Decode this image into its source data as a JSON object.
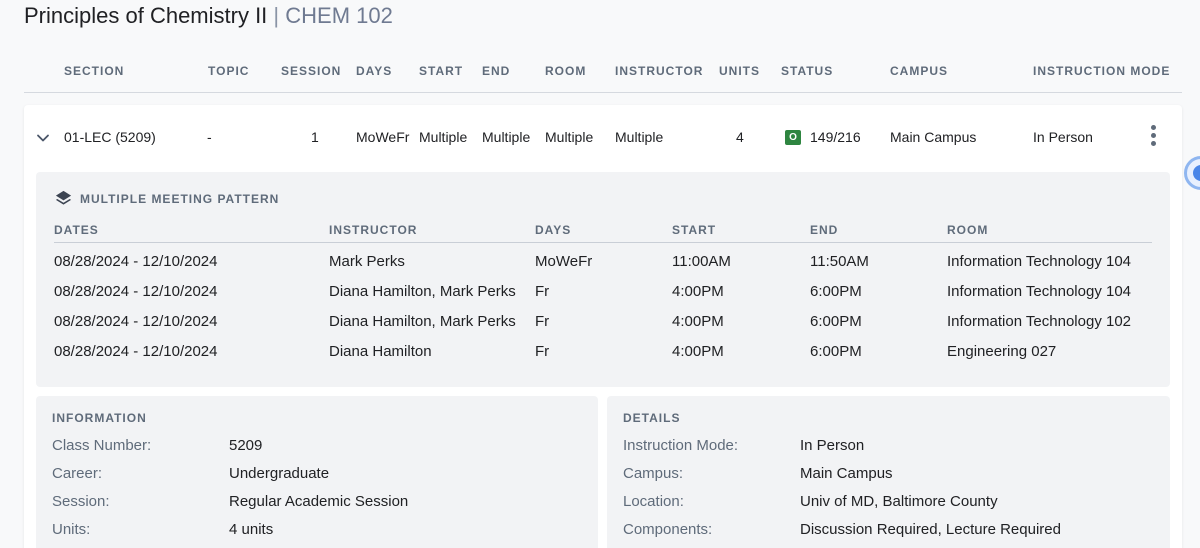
{
  "page": {
    "course_name": "Principles of Chemistry II",
    "separator": "|",
    "course_code": "CHEM 102"
  },
  "columns": {
    "section": "SECTION",
    "topic": "TOPIC",
    "session": "SESSION",
    "days": "DAYS",
    "start": "START",
    "end": "END",
    "room": "ROOM",
    "instructor": "INSTRUCTOR",
    "units": "UNITS",
    "status": "STATUS",
    "campus": "CAMPUS",
    "mode": "INSTRUCTION MODE"
  },
  "row": {
    "section": "01-LEC (5209)",
    "topic": "-",
    "session": "1",
    "days": "MoWeFr",
    "start": "Multiple",
    "end": "Multiple",
    "room": "Multiple",
    "instructor": "Multiple",
    "units": "4",
    "status_badge": "O",
    "status_badge_color": "#2e8540",
    "enrollment": "149/216",
    "campus": "Main Campus",
    "mode": "In Person",
    "expand_icon": "chevron-down-icon",
    "menu_icon": "more-vertical-icon"
  },
  "meeting_pattern": {
    "title": "MULTIPLE MEETING PATTERN",
    "icon": "layers-icon",
    "headers": {
      "dates": "DATES",
      "instructor": "INSTRUCTOR",
      "days": "DAYS",
      "start": "START",
      "end": "END",
      "room": "ROOM"
    },
    "rows": [
      {
        "dates": "08/28/2024 - 12/10/2024",
        "instructor": "Mark Perks",
        "days": "MoWeFr",
        "start": "11:00AM",
        "end": "11:50AM",
        "room": "Information Technology 104"
      },
      {
        "dates": "08/28/2024 - 12/10/2024",
        "instructor": "Diana Hamilton, Mark Perks",
        "days": "Fr",
        "start": "4:00PM",
        "end": "6:00PM",
        "room": "Information Technology 104"
      },
      {
        "dates": "08/28/2024 - 12/10/2024",
        "instructor": "Diana Hamilton, Mark Perks",
        "days": "Fr",
        "start": "4:00PM",
        "end": "6:00PM",
        "room": "Information Technology 102"
      },
      {
        "dates": "08/28/2024 - 12/10/2024",
        "instructor": "Diana Hamilton",
        "days": "Fr",
        "start": "4:00PM",
        "end": "6:00PM",
        "room": "Engineering 027"
      }
    ]
  },
  "information": {
    "title": "INFORMATION",
    "items": [
      {
        "label": "Class Number:",
        "value": "5209"
      },
      {
        "label": "Career:",
        "value": "Undergraduate"
      },
      {
        "label": "Session:",
        "value": "Regular Academic Session"
      },
      {
        "label": "Units:",
        "value": "4 units"
      }
    ]
  },
  "details": {
    "title": "DETAILS",
    "items": [
      {
        "label": "Instruction Mode:",
        "value": "In Person"
      },
      {
        "label": "Campus:",
        "value": "Main Campus"
      },
      {
        "label": "Location:",
        "value": "Univ of MD, Baltimore County"
      },
      {
        "label": "Components:",
        "value": "Discussion Required, Lecture Required"
      }
    ]
  }
}
